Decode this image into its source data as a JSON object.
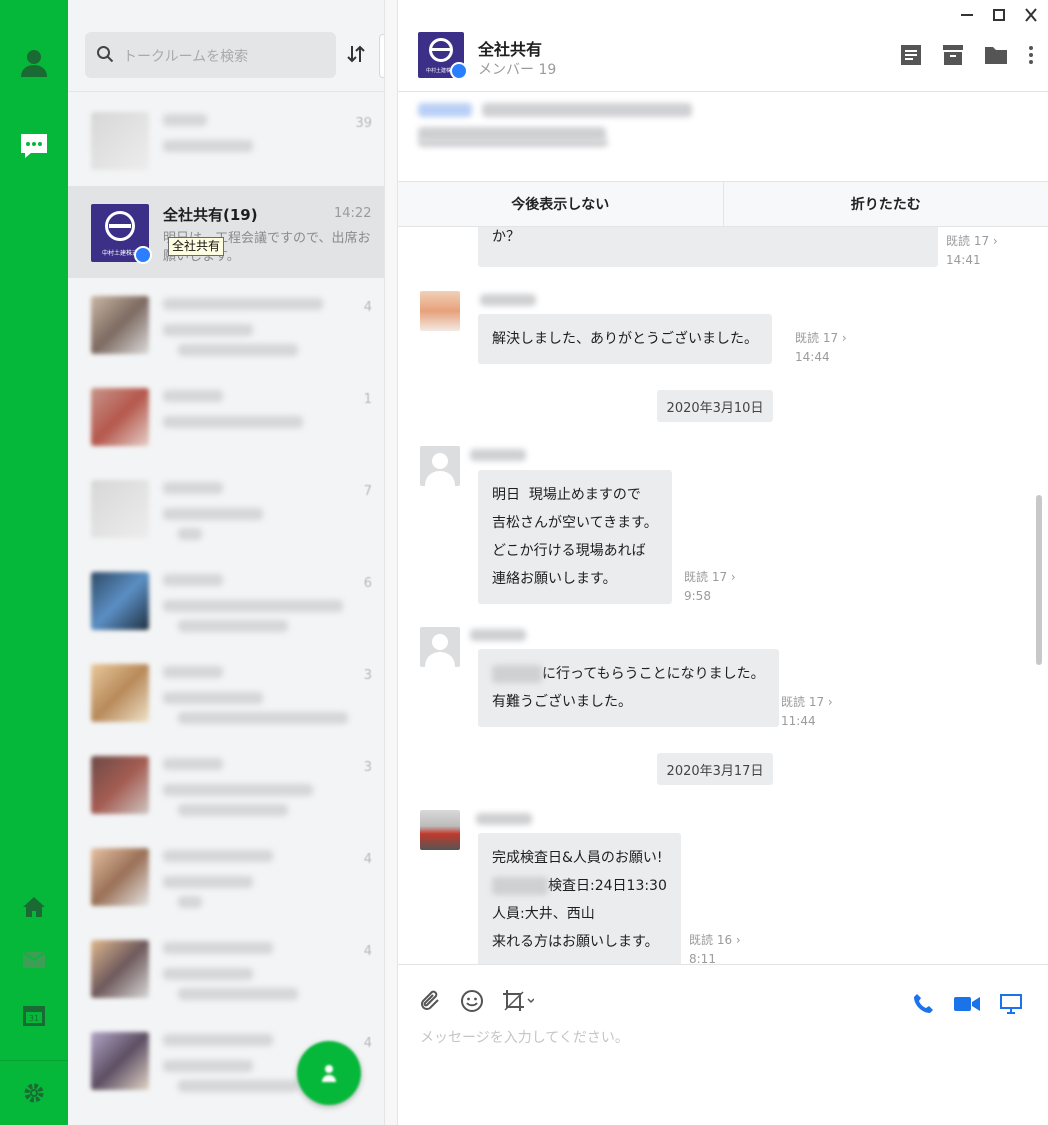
{
  "search": {
    "placeholder": "トークルームを検索"
  },
  "active_chat": {
    "name": "全社共有(19)",
    "time": "14:22",
    "preview": "明日は、工程会議ですので、出席お願いします。",
    "tooltip": "全社共有",
    "logo_text": "中村土建株式"
  },
  "list_counts": [
    "39",
    "4",
    "1",
    "7",
    "6",
    "3",
    "3",
    "4",
    "4",
    "4"
  ],
  "header": {
    "title": "全社共有",
    "members": "メンバー 19",
    "logo_text": "中村土建株式"
  },
  "notice": {
    "hide_label": "今後表示しない",
    "fold_label": "折りたたむ"
  },
  "messages": {
    "m1": {
      "text": "か？",
      "read": "既読 17",
      "time": "14:41"
    },
    "m2": {
      "text": "解決しました、ありがとうございました。",
      "read": "既読 17",
      "time": "14:44"
    },
    "date1": "2020年3月10日",
    "m3": {
      "lines": [
        "明日  現場止めますので",
        "吉松さんが空いてきます。",
        "どこか行ける現場あれば",
        "連絡お願いします。"
      ],
      "read": "既読 17",
      "time": "9:58"
    },
    "m4": {
      "line1_suffix": "に行ってもらうことになりました。",
      "line2": "有難うございました。",
      "read": "既読 17",
      "time": "11:44"
    },
    "date2": "2020年3月17日",
    "m5": {
      "line1": "完成検査日&人員のお願い!",
      "line2_suffix": "検査日:24日13:30",
      "line3": "人員:大井、西山",
      "line4": "来れる方はお願いします。",
      "read": "既読 16",
      "time": "8:11"
    }
  },
  "composer": {
    "placeholder": "メッセージを入力してください。"
  },
  "colors": {
    "brand_green": "#06b83a",
    "call_blue": "#1a73e8",
    "logo_purple": "#3b2f88"
  }
}
